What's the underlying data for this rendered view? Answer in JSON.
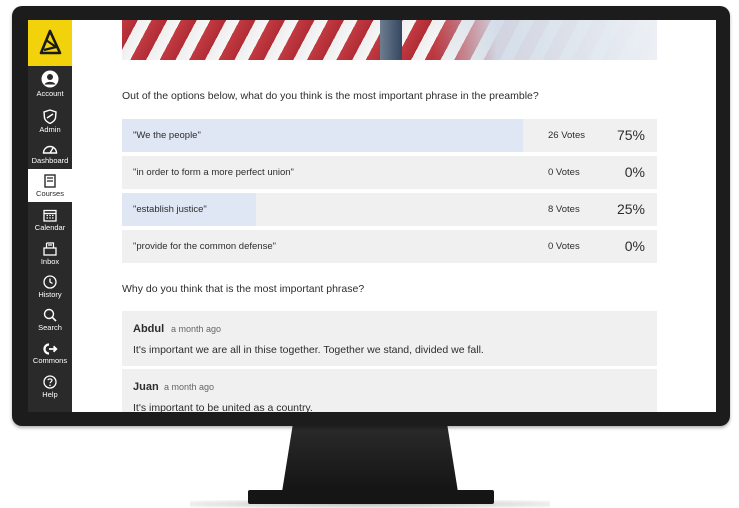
{
  "sidebar": {
    "items": [
      {
        "label": "Account",
        "icon": "user-icon",
        "active": false
      },
      {
        "label": "Admin",
        "icon": "shield-icon",
        "active": false
      },
      {
        "label": "Dashboard",
        "icon": "gauge-icon",
        "active": false
      },
      {
        "label": "Courses",
        "icon": "book-icon",
        "active": true
      },
      {
        "label": "Calendar",
        "icon": "calendar-icon",
        "active": false
      },
      {
        "label": "Inbox",
        "icon": "inbox-icon",
        "active": false
      },
      {
        "label": "History",
        "icon": "clock-icon",
        "active": false
      },
      {
        "label": "Search",
        "icon": "search-icon",
        "active": false
      },
      {
        "label": "Commons",
        "icon": "commons-icon",
        "active": false
      },
      {
        "label": "Help",
        "icon": "help-icon",
        "active": false
      }
    ]
  },
  "poll": {
    "question": "Out of the options below, what do you think is the most important phrase in the preamble?",
    "options": [
      {
        "text": "\"We the people\"",
        "votes": "26 Votes",
        "percent": "75%",
        "share": 0.75
      },
      {
        "text": "\"in order to form a more perfect union\"",
        "votes": "0 Votes",
        "percent": "0%",
        "share": 0
      },
      {
        "text": "\"establish justice\"",
        "votes": "8 Votes",
        "percent": "25%",
        "share": 0.25
      },
      {
        "text": "\"provide for the common defense\"",
        "votes": "0 Votes",
        "percent": "0%",
        "share": 0
      }
    ]
  },
  "discussion": {
    "question": "Why do you think that is the most important phrase?",
    "comments": [
      {
        "author": "Abdul",
        "time": "a month ago",
        "body": "It's important we are all in thise together. Together we stand, divided we fall."
      },
      {
        "author": "Juan",
        "time": "a month ago",
        "body": "It's important to be united as a country."
      }
    ]
  },
  "colors": {
    "brand": "#f2d20a",
    "sidebar": "#2a2a2a",
    "option_fill": "#dfe6f4",
    "row_bg": "#f0f0f0"
  }
}
